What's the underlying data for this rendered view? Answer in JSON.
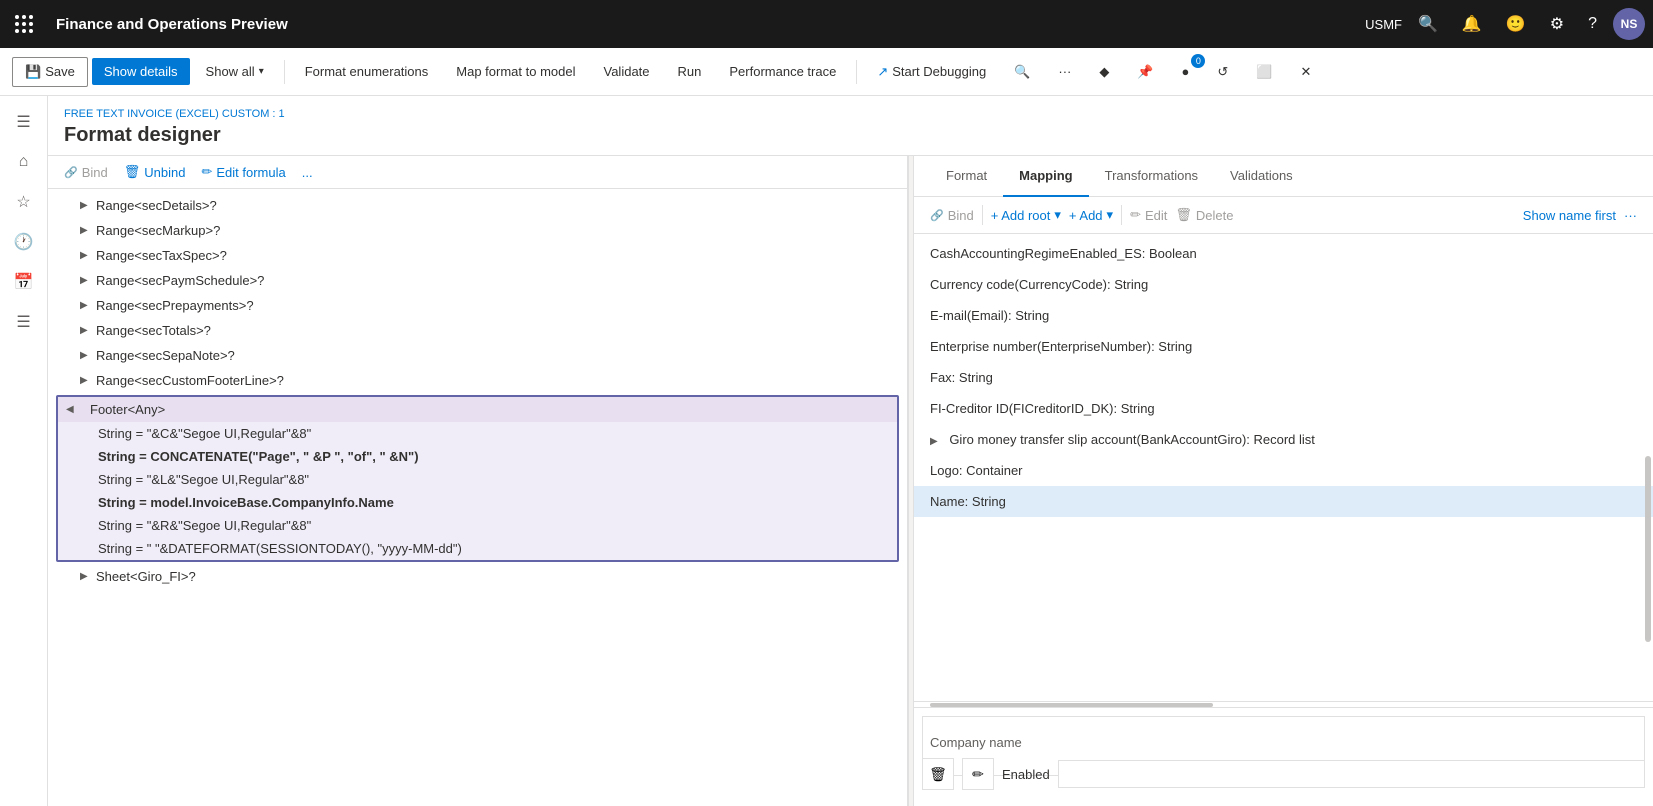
{
  "app": {
    "title": "Finance and Operations Preview",
    "env": "USMF",
    "user_initials": "NS"
  },
  "toolbar": {
    "save_label": "Save",
    "show_details_label": "Show details",
    "show_all_label": "Show all",
    "format_enumerations_label": "Format enumerations",
    "map_format_to_model_label": "Map format to model",
    "validate_label": "Validate",
    "run_label": "Run",
    "performance_trace_label": "Performance trace",
    "start_debugging_label": "Start Debugging"
  },
  "breadcrumb": "FREE TEXT INVOICE (EXCEL) CUSTOM : 1",
  "page_title": "Format designer",
  "action_bar": {
    "bind_label": "Bind",
    "unbind_label": "Unbind",
    "edit_formula_label": "Edit formula",
    "more_label": "..."
  },
  "tree_items": [
    {
      "label": "Range<secDetails>?",
      "indent": 1,
      "expandable": true
    },
    {
      "label": "Range<secMarkup>?",
      "indent": 1,
      "expandable": true
    },
    {
      "label": "Range<secTaxSpec>?",
      "indent": 1,
      "expandable": true
    },
    {
      "label": "Range<secPaymSchedule>?",
      "indent": 1,
      "expandable": true
    },
    {
      "label": "Range<secPrepayments>?",
      "indent": 1,
      "expandable": true
    },
    {
      "label": "Range<secTotals>?",
      "indent": 1,
      "expandable": true
    },
    {
      "label": "Range<secSepaNote>?",
      "indent": 1,
      "expandable": true
    },
    {
      "label": "Range<secCustomFooterLine>?",
      "indent": 1,
      "expandable": true
    }
  ],
  "footer_group": {
    "header": "Footer<Any>",
    "children": [
      {
        "label": "String = \"&C&\"Segoe UI,Regular\"&8\"",
        "bold": false
      },
      {
        "label": "String = CONCATENATE(\"Page\", \" &P \", \"of\", \" &N\")",
        "bold": true
      },
      {
        "label": "String = \"&L&\"Segoe UI,Regular\"&8\"",
        "bold": false
      },
      {
        "label": "String = model.InvoiceBase.CompanyInfo.Name",
        "bold": true
      },
      {
        "label": "String = \"&R&\"Segoe UI,Regular\"&8\"",
        "bold": false
      },
      {
        "label": "String = \" \"&DATEFORMAT(SESSIONTODAY(), \"yyyy-MM-dd\")",
        "bold": false
      }
    ]
  },
  "sheet_item": {
    "label": "Sheet<Giro_FI>?",
    "indent": 1,
    "expandable": true
  },
  "tabs": [
    {
      "label": "Format",
      "active": false
    },
    {
      "label": "Mapping",
      "active": true
    },
    {
      "label": "Transformations",
      "active": false
    },
    {
      "label": "Validations",
      "active": false
    }
  ],
  "right_action_bar": {
    "bind_label": "Bind",
    "add_root_label": "+ Add root",
    "add_label": "+ Add",
    "edit_label": "Edit",
    "delete_label": "Delete",
    "show_name_first_label": "Show name first"
  },
  "data_items": [
    {
      "label": "CashAccountingRegimeEnabled_ES: Boolean",
      "expandable": false
    },
    {
      "label": "Currency code(CurrencyCode): String",
      "expandable": false
    },
    {
      "label": "E-mail(Email): String",
      "expandable": false
    },
    {
      "label": "Enterprise number(EnterpriseNumber): String",
      "expandable": false
    },
    {
      "label": "Fax: String",
      "expandable": false
    },
    {
      "label": "FI-Creditor ID(FICreditorID_DK): String",
      "expandable": false
    },
    {
      "label": "Giro money transfer slip account(BankAccountGiro): Record list",
      "expandable": true
    },
    {
      "label": "Logo: Container",
      "expandable": false
    },
    {
      "label": "Name: String",
      "selected": true,
      "expandable": false
    }
  ],
  "bottom": {
    "company_name_label": "Company name",
    "enabled_label": "Enabled"
  }
}
